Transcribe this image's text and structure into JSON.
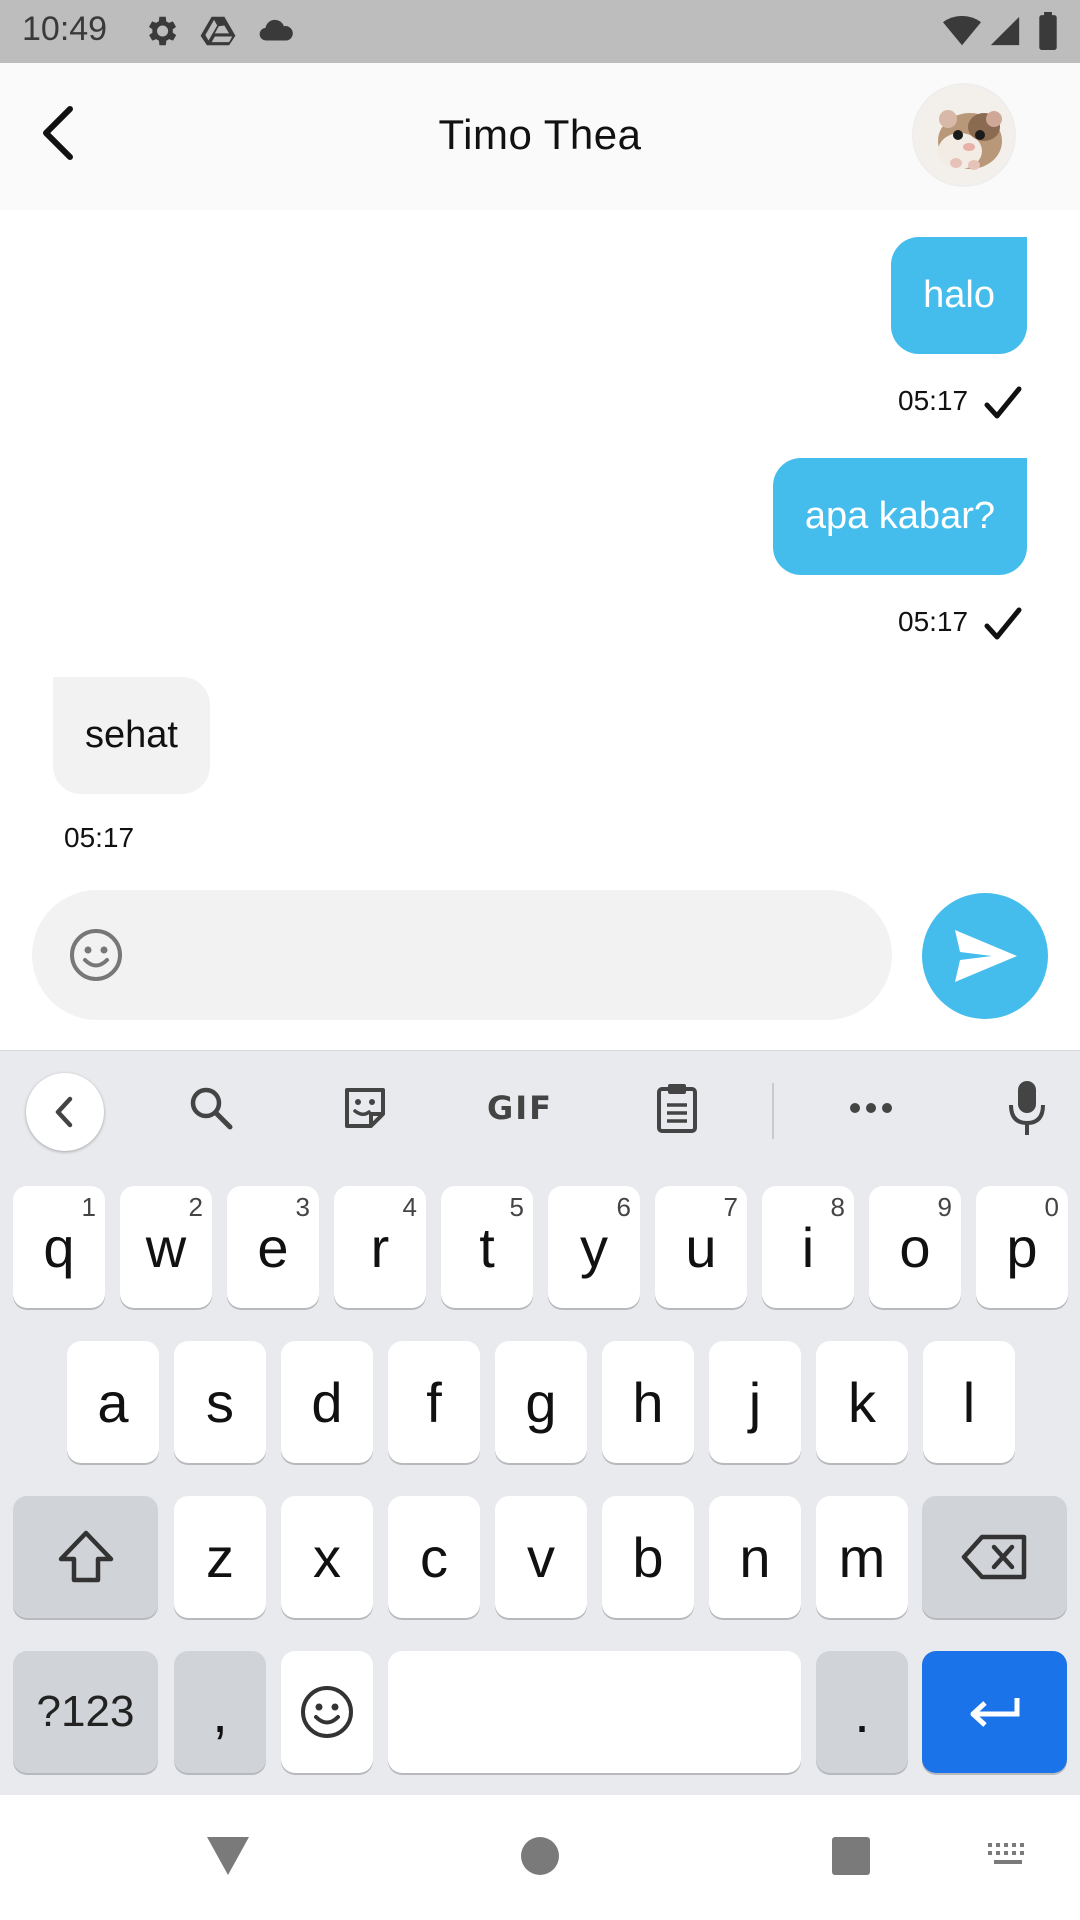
{
  "status_bar": {
    "time": "10:49",
    "icons": [
      "gear-icon",
      "drive-icon",
      "cloud-icon",
      "wifi-icon",
      "signal-icon",
      "battery-icon"
    ]
  },
  "header": {
    "title": "Timo Thea",
    "back_icon": "chevron-left-icon",
    "avatar": "hamster-avatar"
  },
  "messages": [
    {
      "direction": "outgoing",
      "text": "halo",
      "time": "05:17",
      "status_icon": "checkmark-icon"
    },
    {
      "direction": "outgoing",
      "text": "apa kabar?",
      "time": "05:17",
      "status_icon": "checkmark-icon"
    },
    {
      "direction": "incoming",
      "text": "sehat",
      "time": "05:17"
    }
  ],
  "composer": {
    "value": "",
    "placeholder": "",
    "emoji_icon": "smiley-icon",
    "send_icon": "send-icon"
  },
  "keyboard": {
    "toolbar": {
      "collapse_icon": "chevron-left-icon",
      "search_icon": "search-icon",
      "sticker_icon": "sticker-icon",
      "gif_label": "GIF",
      "clipboard_icon": "clipboard-icon",
      "more_icon": "more-dots-icon",
      "mic_icon": "microphone-icon"
    },
    "row1": [
      {
        "k": "q",
        "h": "1"
      },
      {
        "k": "w",
        "h": "2"
      },
      {
        "k": "e",
        "h": "3"
      },
      {
        "k": "r",
        "h": "4"
      },
      {
        "k": "t",
        "h": "5"
      },
      {
        "k": "y",
        "h": "6"
      },
      {
        "k": "u",
        "h": "7"
      },
      {
        "k": "i",
        "h": "8"
      },
      {
        "k": "o",
        "h": "9"
      },
      {
        "k": "p",
        "h": "0"
      }
    ],
    "row2": [
      "a",
      "s",
      "d",
      "f",
      "g",
      "h",
      "j",
      "k",
      "l"
    ],
    "row3": [
      "z",
      "x",
      "c",
      "v",
      "b",
      "n",
      "m"
    ],
    "symbols_label": "?123",
    "comma_label": ",",
    "period_label": ".",
    "shift_icon": "shift-icon",
    "backspace_icon": "backspace-icon",
    "emoji_key_icon": "smiley-icon",
    "enter_icon": "enter-arrow-icon",
    "accent_color": "#1a73e8"
  },
  "nav_bar": {
    "back_icon": "nav-back-triangle-icon",
    "home_icon": "nav-home-circle-icon",
    "recents_icon": "nav-recents-square-icon",
    "keyboard_icon": "keyboard-switch-icon"
  },
  "colors": {
    "bubble_outgoing": "#45bdec",
    "bubble_incoming": "#f2f2f2",
    "status_bar": "#bdbdbd"
  }
}
